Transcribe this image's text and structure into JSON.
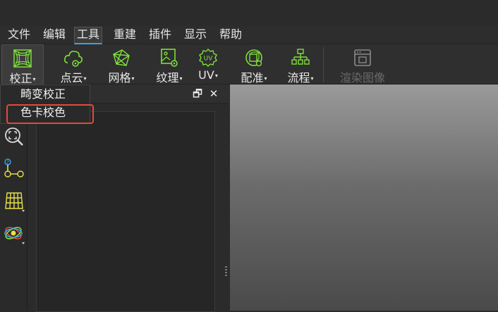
{
  "menubar": {
    "items": [
      "文件",
      "编辑",
      "工具",
      "重建",
      "插件",
      "显示",
      "帮助"
    ],
    "active": "工具"
  },
  "ribbon": {
    "buttons": [
      {
        "label": "校正",
        "icon": "distortion-grid-icon"
      },
      {
        "label": "点云",
        "icon": "cloud-gear-icon"
      },
      {
        "label": "网格",
        "icon": "mesh-icon"
      },
      {
        "label": "纹理",
        "icon": "texture-image-gear-icon"
      },
      {
        "label": "UV",
        "icon": "uv-gear-icon"
      },
      {
        "label": "配准",
        "icon": "registration-icon"
      },
      {
        "label": "流程",
        "icon": "workflow-icon"
      },
      {
        "label": "渲染图像",
        "icon": "render-image-icon",
        "disabled": true
      }
    ],
    "dropdown_arrow": "▾"
  },
  "dropdown": {
    "items": [
      "畸变校正",
      "色卡校色"
    ],
    "highlighted": "色卡校色"
  },
  "panel": {
    "restore_glyph": "🗗",
    "close_glyph": "✕"
  },
  "colors": {
    "icon_green": "#7ee03a",
    "highlight_red": "#e24a3a",
    "accent_blue": "#3aa0e8"
  }
}
